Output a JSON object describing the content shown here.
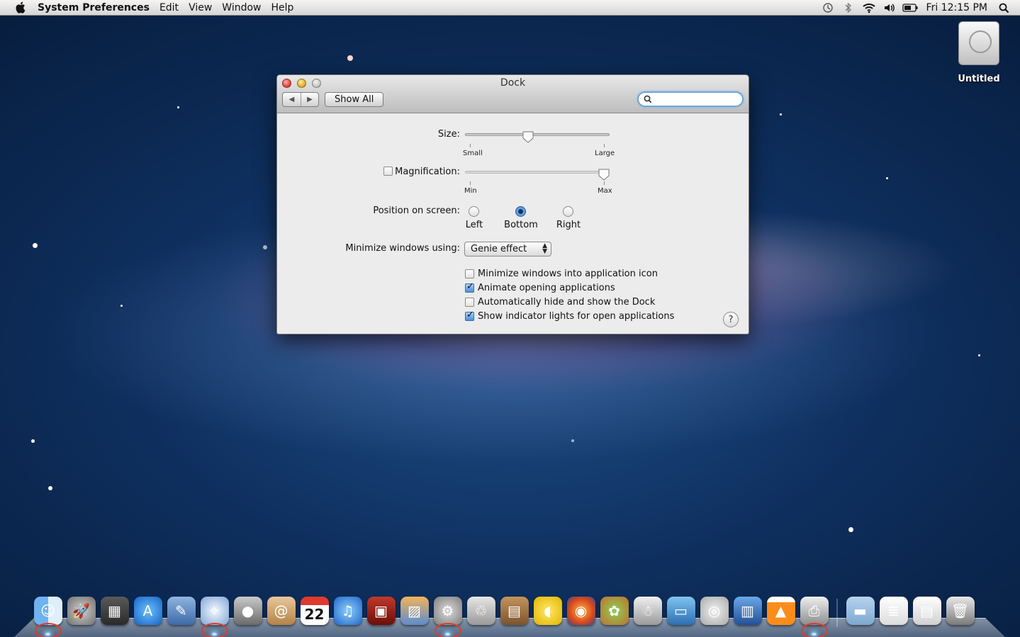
{
  "menubar": {
    "app_name": "System Preferences",
    "menus": [
      "Edit",
      "View",
      "Window",
      "Help"
    ],
    "clock": "Fri 12:15 PM"
  },
  "desktop": {
    "drive_label": "Untitled"
  },
  "window": {
    "title": "Dock",
    "show_all": "Show All",
    "search_value": "",
    "size_label": "Size:",
    "size_min": "Small",
    "size_max": "Large",
    "size_value": 0.43,
    "magnification_label": "Magnification:",
    "magnification_checked": false,
    "mag_min": "Min",
    "mag_max": "Max",
    "mag_value": 1.0,
    "position_label": "Position on screen:",
    "positions": [
      "Left",
      "Bottom",
      "Right"
    ],
    "position_selected": "Bottom",
    "minimize_label": "Minimize windows using:",
    "minimize_effect": "Genie effect",
    "options": [
      {
        "label": "Minimize windows into application icon",
        "checked": false
      },
      {
        "label": "Animate opening applications",
        "checked": true
      },
      {
        "label": "Automatically hide and show the Dock",
        "checked": false
      },
      {
        "label": "Show indicator lights for open applications",
        "checked": true
      }
    ],
    "help": "?"
  },
  "dock": {
    "calendar_day": "22",
    "items": [
      {
        "name": "finder",
        "running": true,
        "highlighted": true
      },
      {
        "name": "launchpad"
      },
      {
        "name": "mission-control"
      },
      {
        "name": "app-store"
      },
      {
        "name": "preview"
      },
      {
        "name": "safari",
        "running": true,
        "highlighted": true
      },
      {
        "name": "facetime"
      },
      {
        "name": "address-book"
      },
      {
        "name": "ical"
      },
      {
        "name": "itunes"
      },
      {
        "name": "photo-booth"
      },
      {
        "name": "iphoto"
      },
      {
        "name": "system-preferences",
        "running": true,
        "highlighted": true
      },
      {
        "name": "trash-app"
      },
      {
        "name": "archiver"
      },
      {
        "name": "cyberduck"
      },
      {
        "name": "firefox"
      },
      {
        "name": "adium"
      },
      {
        "name": "automator"
      },
      {
        "name": "virtualbox"
      },
      {
        "name": "disk-utility"
      },
      {
        "name": "toast"
      },
      {
        "name": "vlc"
      },
      {
        "name": "printer",
        "running": true,
        "highlighted": true
      },
      {
        "name": "documents-folder"
      },
      {
        "name": "downloads-stack"
      },
      {
        "name": "screenshots-stack"
      },
      {
        "name": "trash"
      }
    ]
  }
}
